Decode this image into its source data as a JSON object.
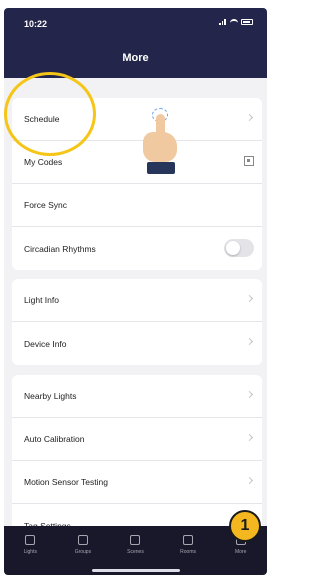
{
  "status_bar": {
    "time": "10:22"
  },
  "header": {
    "title": "More"
  },
  "groups": [
    {
      "items": [
        {
          "label": "Schedule",
          "accessory": "chevron"
        },
        {
          "label": "My Codes",
          "accessory": "qr-icon"
        },
        {
          "label": "Force Sync",
          "accessory": "none"
        },
        {
          "label": "Circadian Rhythms",
          "accessory": "toggle",
          "toggle_on": false
        }
      ]
    },
    {
      "items": [
        {
          "label": "Light Info",
          "accessory": "chevron"
        },
        {
          "label": "Device Info",
          "accessory": "chevron"
        }
      ]
    },
    {
      "items": [
        {
          "label": "Nearby Lights",
          "accessory": "chevron"
        },
        {
          "label": "Auto Calibration",
          "accessory": "chevron"
        },
        {
          "label": "Motion Sensor Testing",
          "accessory": "chevron"
        },
        {
          "label": "Tag Settings",
          "accessory": "none"
        }
      ]
    }
  ],
  "callout": {
    "number": "1"
  },
  "tab_bar": {
    "tabs": [
      {
        "label": "Lights",
        "icon": "bulb-icon"
      },
      {
        "label": "Groups",
        "icon": "groups-icon"
      },
      {
        "label": "Scenes",
        "icon": "scenes-icon"
      },
      {
        "label": "Rooms",
        "icon": "rooms-icon"
      },
      {
        "label": "More",
        "icon": "more-icon"
      }
    ]
  },
  "colors": {
    "header_bg": "#23264a",
    "tabbar_bg": "#18182a",
    "highlight": "#f5c518",
    "badge": "#f5b71f"
  }
}
